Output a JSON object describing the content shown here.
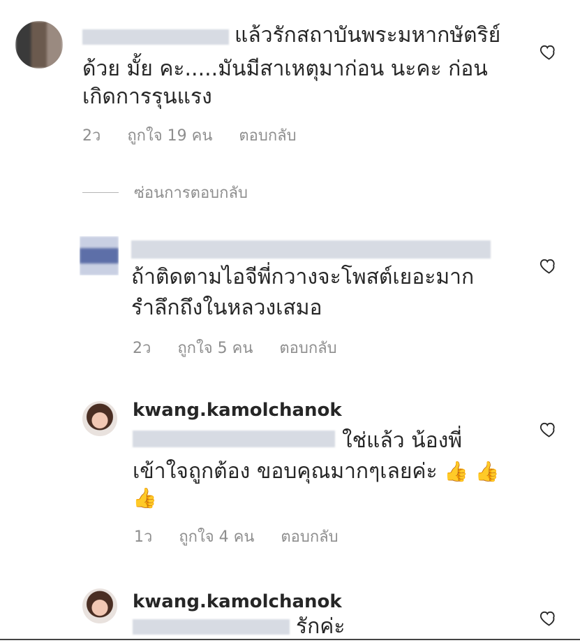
{
  "comments": [
    {
      "text_line1": "แล้วรักสถาบันพระมหากษัตริย์",
      "text_line2": "ด้วย มั้ย คะ.....มันมีสาเหตุมาก่อน นะคะ ก่อน",
      "text_line3": "เกิดการรุนแรง",
      "time": "2ว",
      "likes": "ถูกใจ 19 คน",
      "reply": "ตอบกลับ"
    },
    {
      "text_line1": "ถ้าติดตามไอจีพี่กวางจะโพสต์เยอะมาก",
      "text_line2": "รำลึกถึงในหลวงเสมอ",
      "time": "2ว",
      "likes": "ถูกใจ 5 คน",
      "reply": "ตอบกลับ"
    },
    {
      "username": "kwang.kamolchanok",
      "text_line1": "ใช่แล้ว น้องพี่",
      "text_line2": "เข้าใจถูกต้อง ขอบคุณมากๆเลยค่ะ",
      "emoji": "👍",
      "time": "1ว",
      "likes": "ถูกใจ 4 คน",
      "reply": "ตอบกลับ"
    },
    {
      "username": "kwang.kamolchanok",
      "text_line1": "รักค่ะ"
    }
  ],
  "hide_replies": "ซ่อนการตอบกลับ",
  "icons": {
    "like": "heart-outline-icon"
  },
  "colors": {
    "text": "#262626",
    "meta": "#8e8e8e"
  }
}
